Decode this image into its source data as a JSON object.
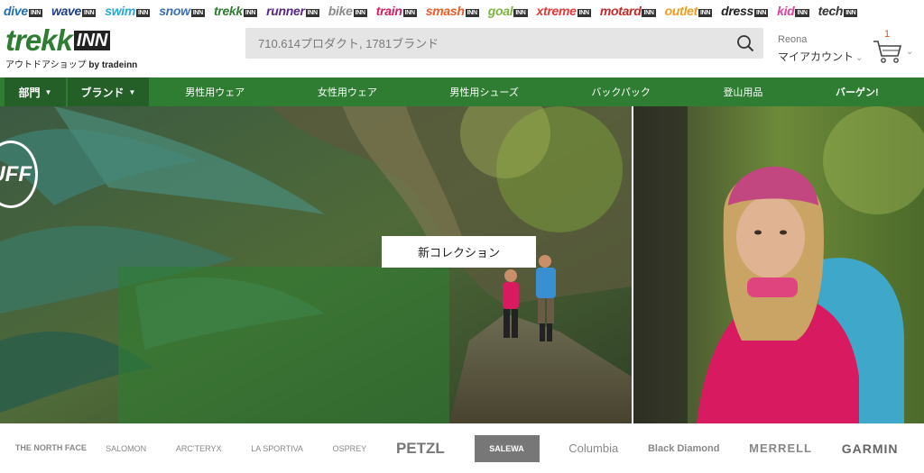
{
  "stores": [
    {
      "name": "dive",
      "color": "#1f6fb2"
    },
    {
      "name": "wave",
      "color": "#1c3f8c"
    },
    {
      "name": "swim",
      "color": "#27a7dc"
    },
    {
      "name": "snow",
      "color": "#3a6fb5"
    },
    {
      "name": "trekk",
      "color": "#2e7d32"
    },
    {
      "name": "runner",
      "color": "#5b2a86"
    },
    {
      "name": "bike",
      "color": "#8a8a8a"
    },
    {
      "name": "train",
      "color": "#d81b60"
    },
    {
      "name": "smash",
      "color": "#ef5a24"
    },
    {
      "name": "goal",
      "color": "#7cb342"
    },
    {
      "name": "xtreme",
      "color": "#e53935"
    },
    {
      "name": "motard",
      "color": "#c62828"
    },
    {
      "name": "outlet",
      "color": "#f29b1d"
    },
    {
      "name": "dress",
      "color": "#222222"
    },
    {
      "name": "kid",
      "color": "#e040a0"
    },
    {
      "name": "tech",
      "color": "#333333"
    }
  ],
  "store_inn_label": "INN",
  "logo": {
    "word": "trekk",
    "inn": "INN",
    "tagline": "アウトドアショップ",
    "by": "by tradeinn"
  },
  "search": {
    "placeholder": "710.614プロダクト, 1781ブランド",
    "icon": "search-icon"
  },
  "account": {
    "username": "Reona",
    "label": "マイアカウント",
    "chevron": "⌄"
  },
  "cart": {
    "count": "1",
    "icon": "cart-icon"
  },
  "nav": {
    "departments": "部門",
    "brands": "ブランド",
    "caret": "▼",
    "links": [
      "男性用ウェア",
      "女性用ウェア",
      "男性用シューズ",
      "バックパック",
      "登山用品",
      "バーゲン!"
    ]
  },
  "hero": {
    "cta": "新コレクション",
    "buff_badge": "UFF"
  },
  "brands": [
    "THE NORTH FACE",
    "SALOMON",
    "ARC'TERYX",
    "LA SPORTIVA",
    "OSPREY",
    "PETZL",
    "SALEWA",
    "Columbia",
    "Black Diamond",
    "MERRELL",
    "GARMIN"
  ],
  "colors": {
    "brand_green": "#2e7d32",
    "nav_dark": "#245f28",
    "cart_badge": "#e65100"
  }
}
